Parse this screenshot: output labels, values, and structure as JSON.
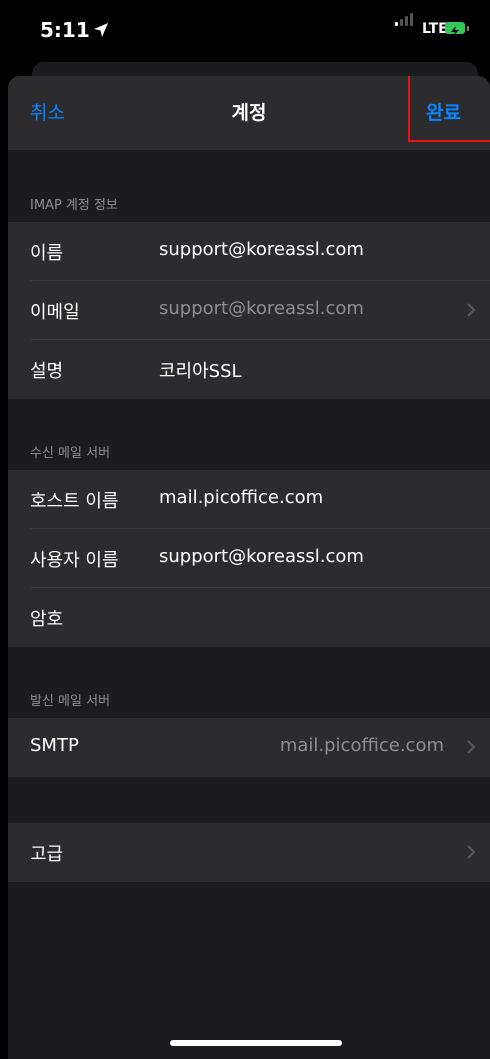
{
  "status_bar": {
    "time": "5:11",
    "network": "LTE"
  },
  "nav": {
    "cancel": "취소",
    "title": "계정",
    "done": "완료"
  },
  "sections": {
    "account_info": {
      "header": "IMAP 계정 정보",
      "rows": [
        {
          "label": "이름",
          "value": "support@koreassl.com"
        },
        {
          "label": "이메일",
          "value": "support@koreassl.com"
        },
        {
          "label": "설명",
          "value": "코리아SSL"
        }
      ]
    },
    "incoming": {
      "header": "수신 메일 서버",
      "rows": [
        {
          "label": "호스트 이름",
          "value": "mail.picoffice.com"
        },
        {
          "label": "사용자 이름",
          "value": "support@koreassl.com"
        },
        {
          "label": "암호",
          "value": ""
        }
      ]
    },
    "outgoing": {
      "header": "발신 메일 서버",
      "rows": [
        {
          "label": "SMTP",
          "value": "mail.picoffice.com"
        }
      ]
    },
    "advanced": {
      "label": "고급"
    }
  },
  "colors": {
    "accent": "#0a84ff",
    "highlight": "#e11111",
    "battery": "#34c759"
  }
}
